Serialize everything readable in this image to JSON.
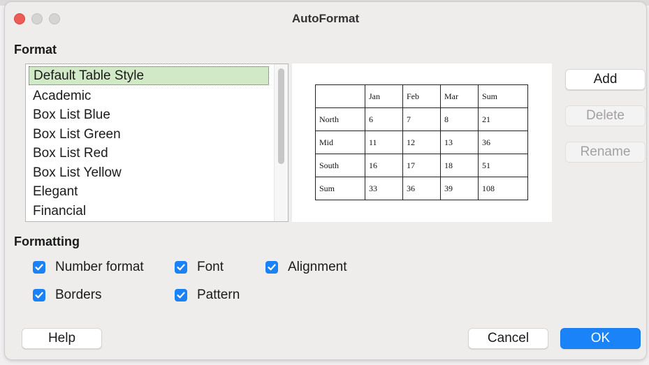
{
  "window": {
    "title": "AutoFormat"
  },
  "format_section": {
    "label": "Format",
    "styles": [
      "Default Table Style",
      "Academic",
      "Box List Blue",
      "Box List Green",
      "Box List Red",
      "Box List Yellow",
      "Elegant",
      "Financial"
    ],
    "selected_index": 0
  },
  "preview": {
    "header": [
      "",
      "Jan",
      "Feb",
      "Mar",
      "Sum"
    ],
    "rows": [
      [
        "North",
        "6",
        "7",
        "8",
        "21"
      ],
      [
        "Mid",
        "11",
        "12",
        "13",
        "36"
      ],
      [
        "South",
        "16",
        "17",
        "18",
        "51"
      ],
      [
        "Sum",
        "33",
        "36",
        "39",
        "108"
      ]
    ]
  },
  "side_buttons": {
    "add": "Add",
    "delete": "Delete",
    "rename": "Rename"
  },
  "formatting_section": {
    "label": "Formatting",
    "options": [
      {
        "label": "Number format",
        "checked": true
      },
      {
        "label": "Font",
        "checked": true
      },
      {
        "label": "Alignment",
        "checked": true
      },
      {
        "label": "Borders",
        "checked": true
      },
      {
        "label": "Pattern",
        "checked": true
      }
    ]
  },
  "footer": {
    "help": "Help",
    "cancel": "Cancel",
    "ok": "OK"
  },
  "colors": {
    "accent": "#1a82f6",
    "selection": "#d2e9c8",
    "close_button": "#ee5c56"
  },
  "icons": {
    "close": "close-traffic-light",
    "minimize": "minimize-traffic-light",
    "maximize": "maximize-traffic-light",
    "checkbox": "checkmark-icon"
  }
}
